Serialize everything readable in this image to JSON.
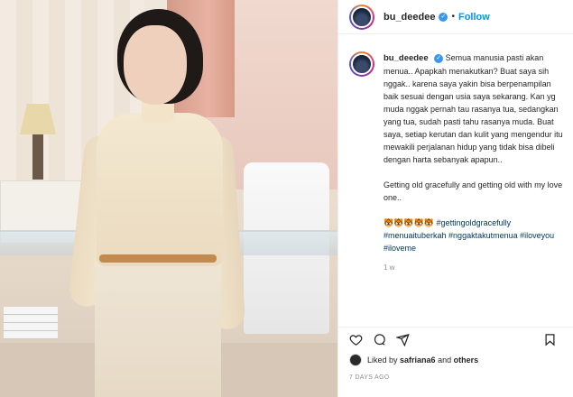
{
  "post": {
    "username": "bu_deedee",
    "follow_label": "Follow",
    "dot": "•",
    "caption": {
      "p1": "Semua manusia pasti akan menua.. Apapkah menakutkan? Buat saya sih nggak.. karena saya yakin bisa berpenampilan baik sesuai dengan usia saya sekarang. Kan yg muda nggak pernah tau rasanya tua, sedangkan yang tua, sudah pasti tahu rasanya muda. Buat saya, setiap kerutan dan kulit yang mengendur itu mewakili perjalanan hidup yang tidak bisa dibeli dengan harta sebanyak apapun..",
      "p2": "Getting old gracefully and getting old with my love one..",
      "emojis": "🐯🐯🐯🐯🐯",
      "hashtags": "#gettingoldgracefully #menuaituberkah #nggaktakutmenua #iloveyou #iloveme"
    },
    "caption_age": "1 w",
    "likes": {
      "prefix": "Liked by ",
      "user": "safriana6",
      "mid": " and ",
      "others": "others"
    },
    "posted": "7 DAYS AGO"
  },
  "icons": [
    "heart-icon",
    "comment-icon",
    "share-icon",
    "save-icon",
    "verified-icon"
  ],
  "colors": {
    "link": "#0095f6",
    "hashtag": "#00376b",
    "muted": "#8e8e8e",
    "verified": "#3897f0"
  }
}
